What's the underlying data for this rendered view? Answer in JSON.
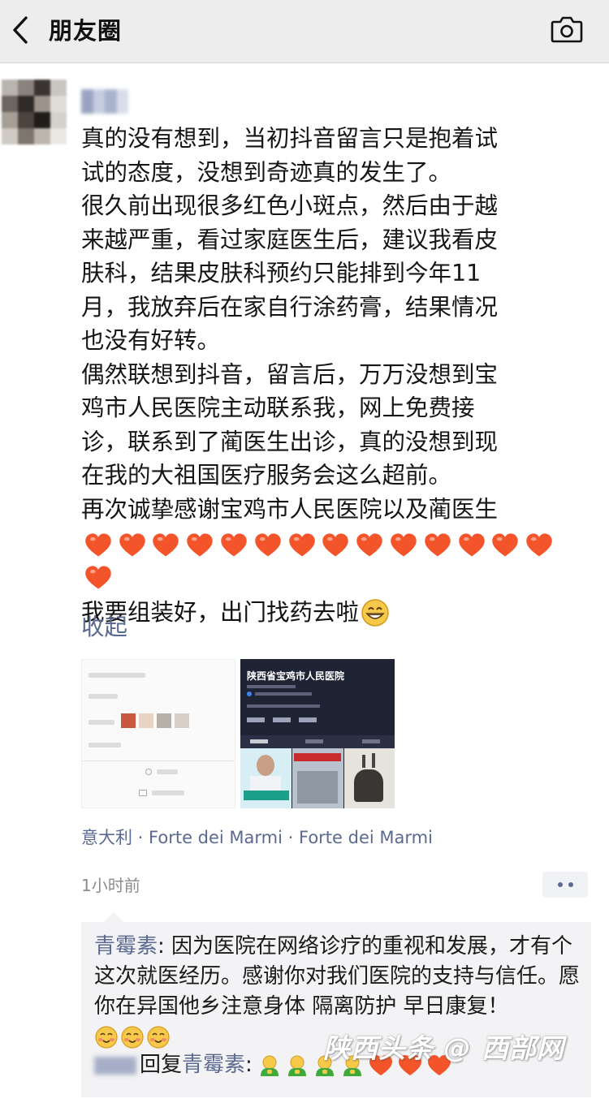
{
  "header": {
    "title": "朋友圈",
    "back_icon": "chevron-left-icon",
    "camera_icon": "camera-icon",
    "background": "#ededed"
  },
  "post": {
    "lines": [
      "真的没有想到，当初抖音留言只是抱着试",
      "试的态度，没想到奇迹真的发生了。",
      "很久前出现很多红色小斑点，然后由于越",
      "来越严重，看过家庭医生后，建议我看皮",
      "肤科，结果皮肤科预约只能排到今年11",
      "月，我放弃后在家自行涂药膏，结果情况",
      "也没有好转。",
      "偶然联想到抖音，留言后，万万没想到宝",
      "鸡市人民医院主动联系我，网上免费接",
      "诊，联系到了蔺医生出诊，真的没想到现",
      "在我的大祖国医疗服务会这么超前。",
      "再次诚挚感谢宝鸡市人民医院以及蔺医生"
    ],
    "heart_count": 15,
    "heart_color": "#f4542a",
    "last_line": "我要组装好，出门找药去啦",
    "collapse_label": "收起",
    "link_color": "#5b6a91"
  },
  "thumbnails": {
    "second_title": "陕西省宝鸡市人民医院"
  },
  "location": "意大利 · Forte dei Marmi · Forte dei Marmi",
  "time": "1小时前",
  "comments": {
    "first_name": "青霉素",
    "first_text": ": 因为医院在网络诊疗的重视和发展，才有个这次就医经历。感谢你对我们医院的支持与信任。愿你在异国他乡注意身体 隔离防护 早日康复！",
    "reply_word": "回复",
    "reply_target": "青霉素",
    "reply_colon": ":"
  },
  "watermark": "陕西头条 @ 西部网"
}
